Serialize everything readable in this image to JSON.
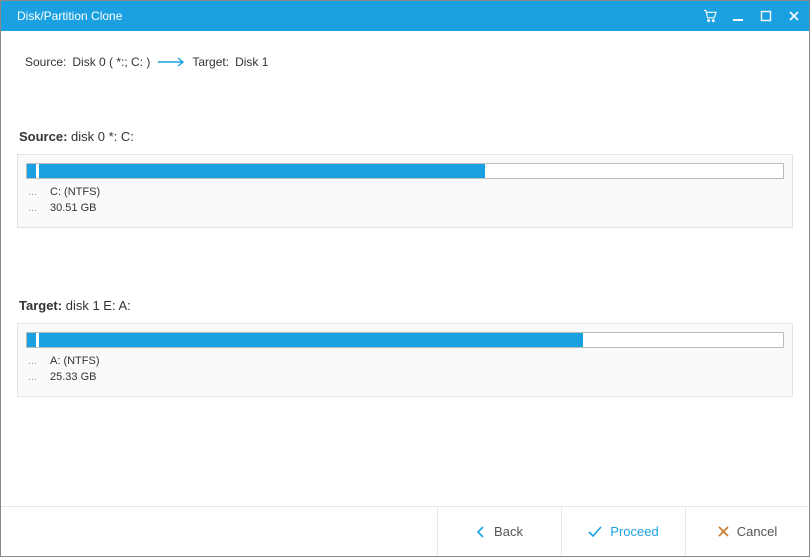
{
  "window": {
    "title": "Disk/Partition Clone"
  },
  "breadcrumb": {
    "source_label": "Source:",
    "source_value": "Disk 0 ( *:; C: )",
    "target_label": "Target:",
    "target_value": "Disk 1"
  },
  "source": {
    "heading_label": "Source:",
    "heading_value": "disk 0 *: C:",
    "partition_label": "C: (NTFS)",
    "size": "30.51 GB",
    "fill_percent": 59
  },
  "target": {
    "heading_label": "Target:",
    "heading_value": "disk 1 E: A:",
    "partition_label": "A: (NTFS)",
    "size": "25.33 GB",
    "fill_percent": 72
  },
  "footer": {
    "back_label": "Back",
    "proceed_label": "Proceed",
    "cancel_label": "Cancel"
  },
  "colors": {
    "accent": "#1ba1e2"
  }
}
